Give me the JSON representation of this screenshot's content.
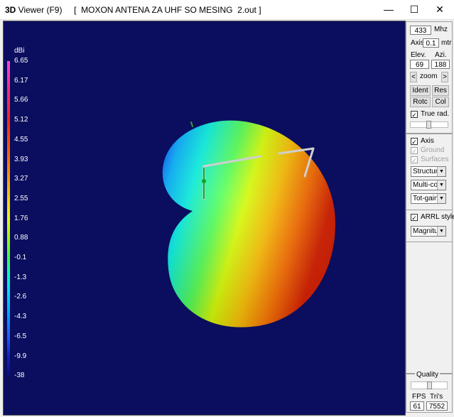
{
  "window": {
    "title_bold": "3D",
    "title_rest": " Viewer (F9)     [  MOXON ANTENA ZA UHF SO MESING  2.out ]",
    "minimize_glyph": "—",
    "maximize_glyph": "☐",
    "close_glyph": "✕"
  },
  "colorbar": {
    "unit": "dBi",
    "labels": [
      "6.65",
      "6.17",
      "5.66",
      "5.12",
      "4.55",
      "3.93",
      "3.27",
      "2.55",
      "1.76",
      "0.88",
      "-0.1",
      "-1.3",
      "-2.6",
      "-4.3",
      "-6.5",
      "-9.9",
      "-38"
    ]
  },
  "panel": {
    "frequency": "433",
    "frequency_unit": "Mhz",
    "axis_label": "Axis",
    "axis_value": "0.1",
    "axis_unit": "mtr",
    "elev_label": "Elev.",
    "azi_label": "Azi.",
    "elev_value": "69",
    "azi_value": "188",
    "zoom_prev": "<",
    "zoom_label": "zoom",
    "zoom_next": ">",
    "ident_label": "Ident",
    "res_label": "Res",
    "rotc_label": "Rotc",
    "col_label": "Col",
    "true_rad_label": "True rad.",
    "axis_check_label": "Axis",
    "ground_label": "Ground",
    "surfaces_label": "Surfaces",
    "check_glyph": "✓",
    "structure_select": "Structure",
    "color_select": "Multi-colo",
    "gain_select": "Tot-gain",
    "arrl_label": "ARRL style",
    "magnitude_select": "Magnitu",
    "quality_label": "Quality",
    "fps_label": "FPS",
    "tris_label": "Tri's",
    "fps_value": "61",
    "tris_value": "7552"
  }
}
